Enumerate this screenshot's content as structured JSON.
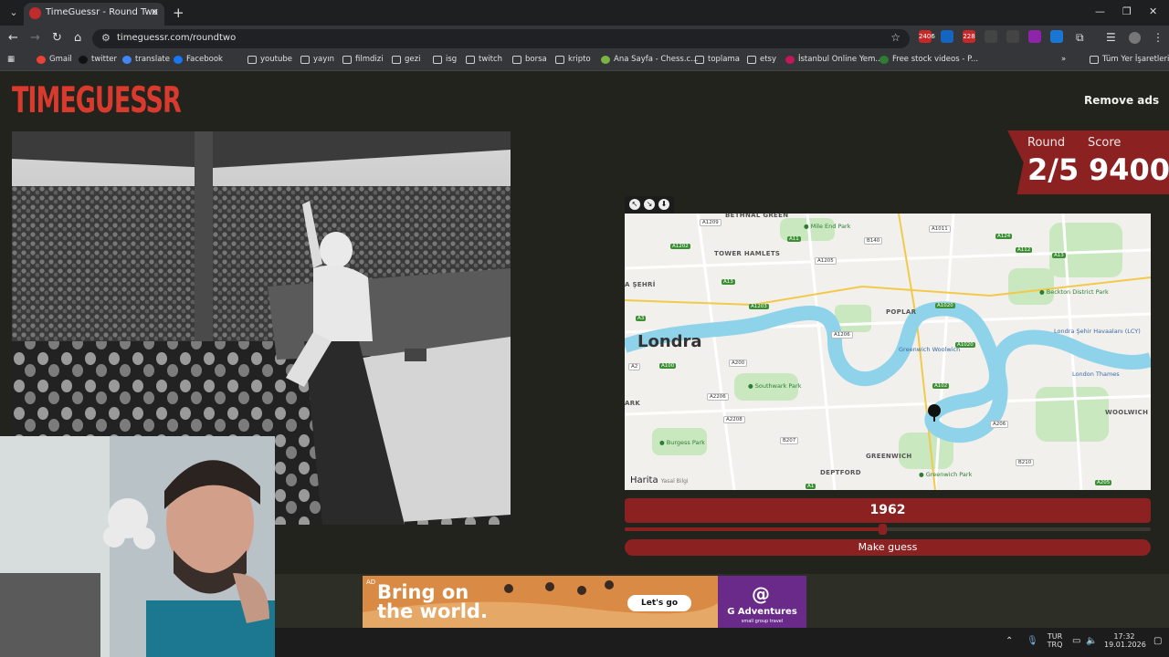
{
  "browser": {
    "tab_title": "TimeGuessr - Round Two",
    "url": "timeguessr.com/roundtwo",
    "extensions": [
      {
        "label": "2406",
        "color": "#c62828"
      },
      {
        "label": "",
        "color": "#1565c0"
      },
      {
        "label": "228",
        "color": "#c62828"
      },
      {
        "label": "",
        "color": "#444444"
      },
      {
        "label": "",
        "color": "#444444"
      },
      {
        "label": "",
        "color": "#8e24aa"
      },
      {
        "label": "",
        "color": "#1976d2"
      }
    ],
    "bookmarks": [
      "Gmail",
      "twitter",
      "translate",
      "Facebook",
      "youtube",
      "yayın",
      "filmdizi",
      "gezi",
      "isg",
      "twitch",
      "borsa",
      "kripto",
      "Ana Sayfa - Chess.c...",
      "toplama",
      "etsy",
      "İstanbul Online Yem...",
      "Free stock videos - P..."
    ],
    "other_bookmarks": "Tüm Yer İşaretleri",
    "overflow": "»"
  },
  "game": {
    "logo": "TIMEGUESSR",
    "remove_ads": "Remove ads",
    "round_label": "Round",
    "round_value": "2/5",
    "score_label": "Score",
    "score_value": "9400",
    "year": "1962",
    "year_fraction": 0.49,
    "make_guess": "Make guess"
  },
  "map": {
    "city": "Londra",
    "attribution": "Harita",
    "attribution_sub": "Yasal Bilgi",
    "districts": [
      "BETHNAL GREEN",
      "TOWER HAMLETS",
      "A ŞEHRİ",
      "POPLAR",
      "DEPTFORD",
      "GREENWICH",
      "WOOLWICH",
      "ARK"
    ],
    "parks": [
      "Mile End Park",
      "Southwark Park",
      "Burgess Park",
      "Greenwich Park",
      "Beckton District Park"
    ],
    "other_labels": [
      "Londra Şehir Havaalanı (LCY)",
      "London Thames",
      "Greenwich Woolwich"
    ],
    "roads": [
      "A1209",
      "A1202",
      "A11",
      "B140",
      "A1011",
      "A124",
      "A112",
      "A13",
      "A1205",
      "A13",
      "A1203",
      "A1020",
      "A1206",
      "A1020",
      "A3",
      "A2",
      "A100",
      "A200",
      "A2206",
      "A2208",
      "B207",
      "A102",
      "A206",
      "B210",
      "A205",
      "A1"
    ]
  },
  "ad": {
    "tag": "AD",
    "headline_1": "Bring on",
    "headline_2": "the world.",
    "cta": "Let's go",
    "brand": "G Adventures",
    "brand_sub": "small group travel",
    "brand_logo": "@"
  },
  "taskbar": {
    "lang_1": "TUR",
    "lang_2": "TRQ",
    "time": "17:32",
    "date": "19.01.2026"
  }
}
